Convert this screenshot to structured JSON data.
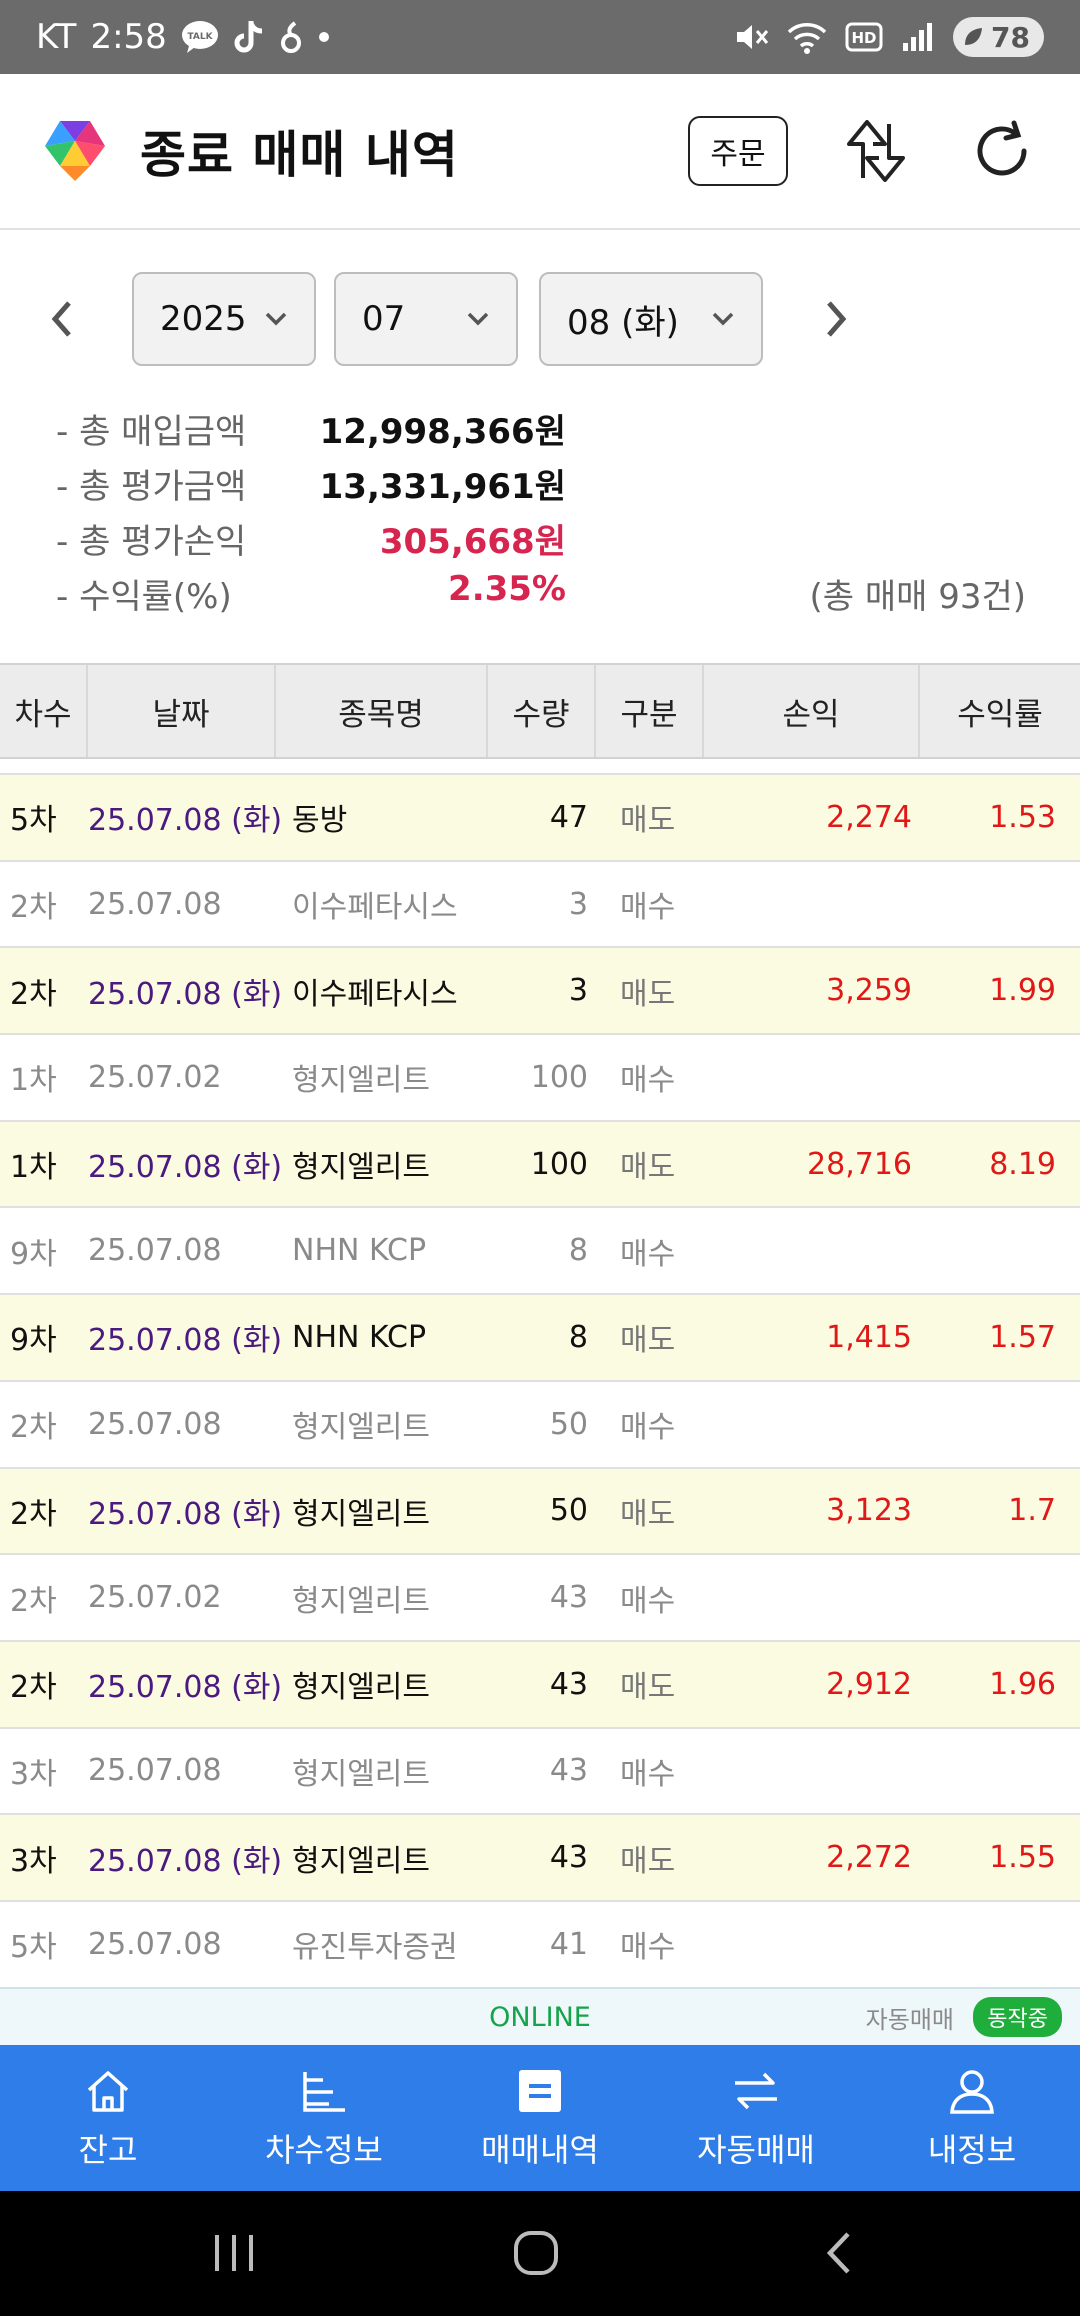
{
  "status_bar": {
    "carrier": "KT",
    "time": "2:58",
    "talk_badge": "TALK",
    "battery": "78"
  },
  "header": {
    "title": "종료 매매 내역",
    "order_button": "주문"
  },
  "date_selector": {
    "year": "2025",
    "month": "07",
    "day": "08 (화)"
  },
  "summary": {
    "items": [
      {
        "label": "- 총 매입금액",
        "value": "12,998,366원"
      },
      {
        "label": "- 총 평가금액",
        "value": "13,331,961원"
      },
      {
        "label": "- 총 평가손익",
        "value": "305,668원"
      },
      {
        "label": "- 수익률(%)",
        "value": "2.35%"
      }
    ],
    "total_count": "(총 매매 93건)"
  },
  "table": {
    "headers": [
      "차수",
      "날짜",
      "종목명",
      "수량",
      "구분",
      "손익",
      "수익률"
    ],
    "rows": [
      {
        "round": "5차",
        "date": "25.07.08 (화)",
        "name": "동방",
        "qty": "47",
        "side": "매도",
        "pl": "2,274",
        "rate": "1.53"
      },
      {
        "round": "2차",
        "date": "25.07.08",
        "name": "이수페타시스",
        "qty": "3",
        "side": "매수",
        "pl": "",
        "rate": ""
      },
      {
        "round": "2차",
        "date": "25.07.08 (화)",
        "name": "이수페타시스",
        "qty": "3",
        "side": "매도",
        "pl": "3,259",
        "rate": "1.99"
      },
      {
        "round": "1차",
        "date": "25.07.02",
        "name": "형지엘리트",
        "qty": "100",
        "side": "매수",
        "pl": "",
        "rate": ""
      },
      {
        "round": "1차",
        "date": "25.07.08 (화)",
        "name": "형지엘리트",
        "qty": "100",
        "side": "매도",
        "pl": "28,716",
        "rate": "8.19"
      },
      {
        "round": "9차",
        "date": "25.07.08",
        "name": "NHN KCP",
        "qty": "8",
        "side": "매수",
        "pl": "",
        "rate": ""
      },
      {
        "round": "9차",
        "date": "25.07.08 (화)",
        "name": "NHN KCP",
        "qty": "8",
        "side": "매도",
        "pl": "1,415",
        "rate": "1.57"
      },
      {
        "round": "2차",
        "date": "25.07.08",
        "name": "형지엘리트",
        "qty": "50",
        "side": "매수",
        "pl": "",
        "rate": ""
      },
      {
        "round": "2차",
        "date": "25.07.08 (화)",
        "name": "형지엘리트",
        "qty": "50",
        "side": "매도",
        "pl": "3,123",
        "rate": "1.7"
      },
      {
        "round": "2차",
        "date": "25.07.02",
        "name": "형지엘리트",
        "qty": "43",
        "side": "매수",
        "pl": "",
        "rate": ""
      },
      {
        "round": "2차",
        "date": "25.07.08 (화)",
        "name": "형지엘리트",
        "qty": "43",
        "side": "매도",
        "pl": "2,912",
        "rate": "1.96"
      },
      {
        "round": "3차",
        "date": "25.07.08",
        "name": "형지엘리트",
        "qty": "43",
        "side": "매수",
        "pl": "",
        "rate": ""
      },
      {
        "round": "3차",
        "date": "25.07.08 (화)",
        "name": "형지엘리트",
        "qty": "43",
        "side": "매도",
        "pl": "2,272",
        "rate": "1.55"
      },
      {
        "round": "5차",
        "date": "25.07.08",
        "name": "유진투자증권",
        "qty": "41",
        "side": "매수",
        "pl": "",
        "rate": ""
      }
    ]
  },
  "status_strip": {
    "online": "ONLINE",
    "auto_trade_label": "자동매매",
    "auto_trade_state": "동작중"
  },
  "bottom_nav": {
    "items": [
      {
        "label": "잔고",
        "icon": "home-icon"
      },
      {
        "label": "차수정보",
        "icon": "tier-info-icon"
      },
      {
        "label": "매매내역",
        "icon": "trade-history-icon"
      },
      {
        "label": "자동매매",
        "icon": "auto-trade-icon"
      },
      {
        "label": "내정보",
        "icon": "profile-icon"
      }
    ]
  },
  "colors": {
    "accent_blue": "#2f7de8",
    "profit_red": "#e01818",
    "summary_red": "#d6254f",
    "sell_row_bg": "#fbfbe1",
    "online_green": "#16a34a"
  }
}
